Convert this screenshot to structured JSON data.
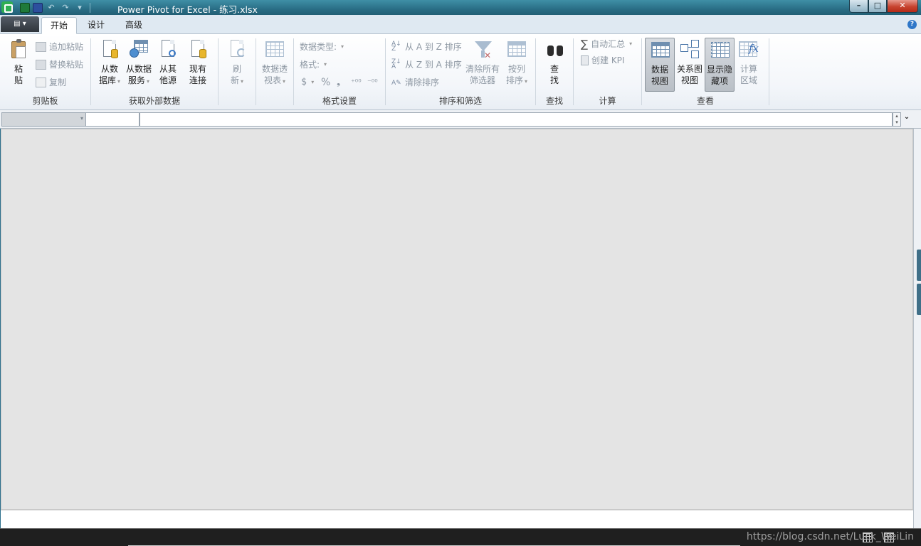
{
  "window": {
    "title": "Power Pivot for Excel - 练习.xlsx",
    "controls": {
      "minimize": "–",
      "maximize": "□",
      "close": "✕"
    }
  },
  "quick_access": {
    "undo": "↶",
    "redo": "↷",
    "customize": "▾"
  },
  "tabs": [
    {
      "label": "开始",
      "active": true
    },
    {
      "label": "设计",
      "active": false
    },
    {
      "label": "高级",
      "active": false
    }
  ],
  "file_menu": {
    "label": "▤ ▾"
  },
  "help": "?",
  "ribbon": {
    "clipboard": {
      "label": "剪贴板",
      "paste": "粘\n贴",
      "paste_append": "追加粘贴",
      "paste_replace": "替换粘贴",
      "copy": "复制"
    },
    "external": {
      "label": "获取外部数据",
      "from_db_1": "从数",
      "from_db_2": "据库",
      "from_service_1": "从数据",
      "from_service_2": "服务",
      "from_other_1": "从其",
      "from_other_2": "他源",
      "existing_1": "现有",
      "existing_2": "连接"
    },
    "refresh": {
      "line1": "刷",
      "line2": "新"
    },
    "pivot": {
      "line1": "数据透",
      "line2": "视表"
    },
    "formatting": {
      "label": "格式设置",
      "data_type": "数据类型:",
      "format": "格式:",
      "currency": "$",
      "percent": "%",
      "comma": "❟",
      "inc_decimal": "⁺⁰⁰",
      "dec_decimal": "⁻⁰⁰"
    },
    "sort_filter": {
      "label": "排序和筛选",
      "sort_az": "从 A 到 Z 排序",
      "sort_za": "从 Z 到 A 排序",
      "clear_sort": "清除排序",
      "clear_filters_1": "清除所有",
      "clear_filters_2": "筛选器",
      "sort_by_col_1": "按列",
      "sort_by_col_2": "排序"
    },
    "find": {
      "label": "查找",
      "line1": "查",
      "line2": "找"
    },
    "calculations": {
      "label": "计算",
      "autosum": "自动汇总",
      "create_kpi": "创建 KPI"
    },
    "view": {
      "label": "查看",
      "data_view_1": "数据",
      "data_view_2": "视图",
      "diagram_view_1": "关系图",
      "diagram_view_2": "视图",
      "show_hidden_1": "显示隐",
      "show_hidden_2": "藏项",
      "calc_area_1": "计算",
      "calc_area_2": "区域"
    }
  },
  "status": {
    "watermark": "https://blog.csdn.net/Luck_WeiLin"
  },
  "colors": {
    "titlebar": "#2a6e86",
    "workspace": "#e4e4e4",
    "statusbar": "#1f1f1f"
  }
}
